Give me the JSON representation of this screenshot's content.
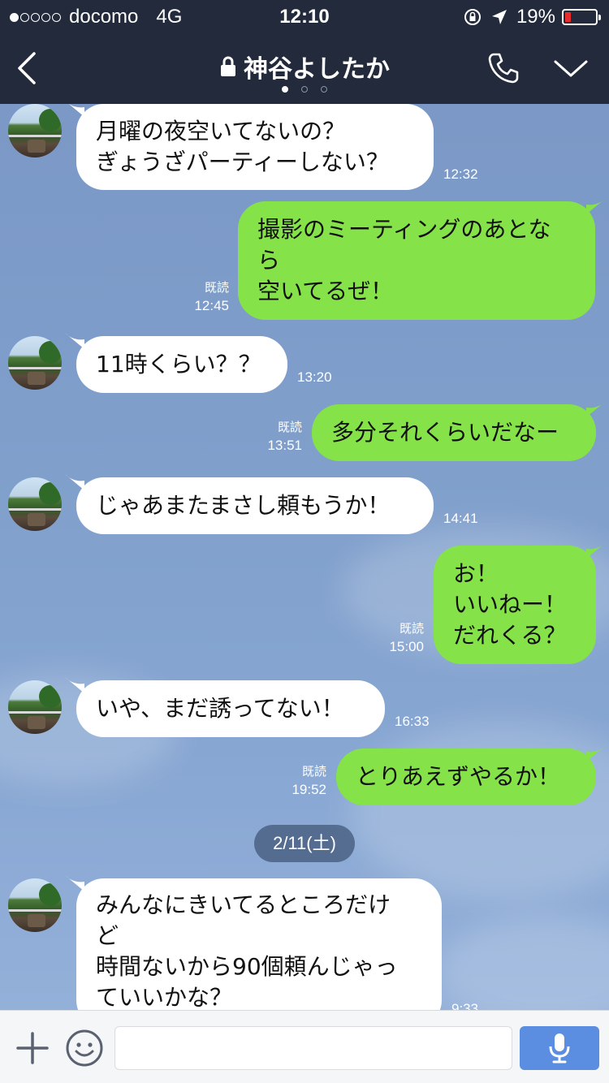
{
  "status_bar": {
    "carrier": "docomo",
    "network": "4G",
    "time": "12:10",
    "battery": "19%",
    "battery_level": 0.19,
    "signal_filled": 1,
    "signal_total": 5
  },
  "header": {
    "title": "神谷よしたか",
    "page_count": 3,
    "active_page": 1
  },
  "messages": [
    {
      "side": "in",
      "lines": [
        "月曜の夜空いてないの？",
        "ぎょうざパーティーしない？"
      ],
      "time": "12:32"
    },
    {
      "side": "out",
      "lines": [
        "撮影のミーティングのあとな",
        "ら",
        "空いてるぜ！"
      ],
      "read": "既読",
      "time": "12:45"
    },
    {
      "side": "in",
      "lines": [
        "11時くらい？？"
      ],
      "time": "13:20"
    },
    {
      "side": "out",
      "lines": [
        "多分それくらいだなー"
      ],
      "read": "既読",
      "time": "13:51"
    },
    {
      "side": "in",
      "lines": [
        "じゃあまたまさし頼もうか！"
      ],
      "time": "14:41"
    },
    {
      "side": "out",
      "lines": [
        "お！",
        "いいねー！",
        "だれくる？"
      ],
      "read": "既読",
      "time": "15:00"
    },
    {
      "side": "in",
      "lines": [
        "いや、まだ誘ってない！"
      ],
      "time": "16:33"
    },
    {
      "side": "out",
      "lines": [
        "とりあえずやるか！"
      ],
      "read": "既読",
      "time": "19:52"
    },
    {
      "side": "in",
      "lines": [
        "みんなにきいてるところだけ",
        "ど",
        "時間ないから90個頼んじゃっ",
        "ていいかな？"
      ],
      "time": "9:33"
    }
  ],
  "date_separator": "2/11(土)",
  "input": {
    "placeholder": "",
    "value": ""
  },
  "icons": {
    "back": "chevron-left-icon",
    "lock": "lock-icon",
    "call": "phone-icon",
    "menu": "chevron-down-icon",
    "plus": "plus-icon",
    "emoji": "emoji-icon",
    "mic": "microphone-icon"
  },
  "colors": {
    "header_bg": "#222a3b",
    "outgoing_bubble": "#85e249",
    "incoming_bubble": "#ffffff",
    "mic_button": "#5b8de0",
    "battery_low": "#e62c2c"
  }
}
